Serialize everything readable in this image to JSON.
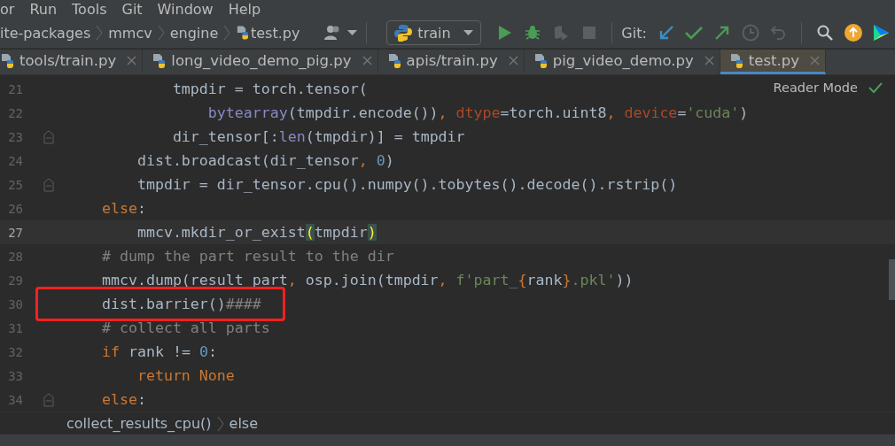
{
  "menu": [
    "or",
    "Run",
    "Tools",
    "Git",
    "Window",
    "Help"
  ],
  "navigation": {
    "breadcrumbs": [
      "ite-packages",
      "mmcv",
      "engine",
      "test.py"
    ],
    "run_config": "train",
    "git_label": "Git:"
  },
  "tabs": [
    {
      "label": "tools/train.py",
      "selected": false
    },
    {
      "label": "long_video_demo_pig.py",
      "selected": false
    },
    {
      "label": "apis/train.py",
      "selected": false
    },
    {
      "label": "pig_video_demo.py",
      "selected": false
    },
    {
      "label": "test.py",
      "selected": true
    }
  ],
  "editor": {
    "reader_mode": "Reader Mode",
    "lines": [
      {
        "number": "21",
        "fold": false,
        "current": false,
        "boxed": false,
        "tokens": [
          {
            "kind": "plain",
            "text": "            tmpdir = torch.tensor("
          }
        ]
      },
      {
        "number": "22",
        "fold": false,
        "current": false,
        "boxed": false,
        "tokens": [
          {
            "kind": "builtin",
            "text": "                bytearray"
          },
          {
            "kind": "plain",
            "text": "(tmpdir.encode())"
          },
          {
            "kind": "keyword",
            "text": ", "
          },
          {
            "kind": "param",
            "text": "dtype"
          },
          {
            "kind": "plain",
            "text": "=torch.uint8"
          },
          {
            "kind": "keyword",
            "text": ", "
          },
          {
            "kind": "param",
            "text": "device"
          },
          {
            "kind": "plain",
            "text": "="
          },
          {
            "kind": "string",
            "text": "'cuda'"
          },
          {
            "kind": "plain",
            "text": ")"
          }
        ]
      },
      {
        "number": "23",
        "fold": true,
        "current": false,
        "boxed": false,
        "tokens": [
          {
            "kind": "plain",
            "text": "            dir_tensor[:"
          },
          {
            "kind": "builtin",
            "text": "len"
          },
          {
            "kind": "plain",
            "text": "(tmpdir)] = tmpdir"
          }
        ]
      },
      {
        "number": "24",
        "fold": false,
        "current": false,
        "boxed": false,
        "tokens": [
          {
            "kind": "plain",
            "text": "        dist.broadcast(dir_tensor"
          },
          {
            "kind": "keyword",
            "text": ", "
          },
          {
            "kind": "number",
            "text": "0"
          },
          {
            "kind": "plain",
            "text": ")"
          }
        ]
      },
      {
        "number": "25",
        "fold": true,
        "current": false,
        "boxed": false,
        "tokens": [
          {
            "kind": "plain",
            "text": "        tmpdir = dir_tensor.cpu().numpy().tobytes().decode().rstrip()"
          }
        ]
      },
      {
        "number": "26",
        "fold": false,
        "current": false,
        "boxed": false,
        "tokens": [
          {
            "kind": "keyword",
            "text": "    else"
          },
          {
            "kind": "plain",
            "text": ":"
          }
        ]
      },
      {
        "number": "27",
        "fold": false,
        "current": true,
        "boxed": false,
        "tokens": [
          {
            "kind": "plain",
            "text": "        mmcv.mkdir_or_exist"
          },
          {
            "kind": "match",
            "text": "("
          },
          {
            "kind": "plain",
            "text": "tmpdir"
          },
          {
            "kind": "match",
            "text": ")"
          }
        ]
      },
      {
        "number": "28",
        "fold": false,
        "current": false,
        "boxed": false,
        "tokens": [
          {
            "kind": "comment",
            "text": "    # dump the part result to the dir"
          }
        ]
      },
      {
        "number": "29",
        "fold": false,
        "current": false,
        "boxed": false,
        "tokens": [
          {
            "kind": "plain",
            "text": "    mmcv.dump(result_part"
          },
          {
            "kind": "keyword",
            "text": ", "
          },
          {
            "kind": "plain",
            "text": "osp.join(tmpdir"
          },
          {
            "kind": "keyword",
            "text": ", "
          },
          {
            "kind": "string",
            "text": "f'part_"
          },
          {
            "kind": "keyword",
            "text": "{"
          },
          {
            "kind": "plain",
            "text": "rank"
          },
          {
            "kind": "keyword",
            "text": "}"
          },
          {
            "kind": "string",
            "text": ".pkl'"
          },
          {
            "kind": "plain",
            "text": "))"
          }
        ]
      },
      {
        "number": "30",
        "fold": false,
        "current": false,
        "boxed": true,
        "tokens": [
          {
            "kind": "plain",
            "text": "    dist.barrier()"
          },
          {
            "kind": "comment",
            "text": "####"
          }
        ]
      },
      {
        "number": "31",
        "fold": false,
        "current": false,
        "boxed": false,
        "tokens": [
          {
            "kind": "comment",
            "text": "    # collect all parts"
          }
        ]
      },
      {
        "number": "32",
        "fold": false,
        "current": false,
        "boxed": false,
        "tokens": [
          {
            "kind": "keyword",
            "text": "    if"
          },
          {
            "kind": "plain",
            "text": " rank != "
          },
          {
            "kind": "number",
            "text": "0"
          },
          {
            "kind": "plain",
            "text": ":"
          }
        ]
      },
      {
        "number": "33",
        "fold": false,
        "current": false,
        "boxed": false,
        "tokens": [
          {
            "kind": "keyword",
            "text": "        return None"
          }
        ]
      },
      {
        "number": "34",
        "fold": true,
        "current": false,
        "boxed": false,
        "tokens": [
          {
            "kind": "keyword",
            "text": "    else"
          },
          {
            "kind": "plain",
            "text": ":"
          }
        ]
      }
    ]
  },
  "code_breadcrumbs": [
    "collect_results_cpu()",
    "else"
  ]
}
